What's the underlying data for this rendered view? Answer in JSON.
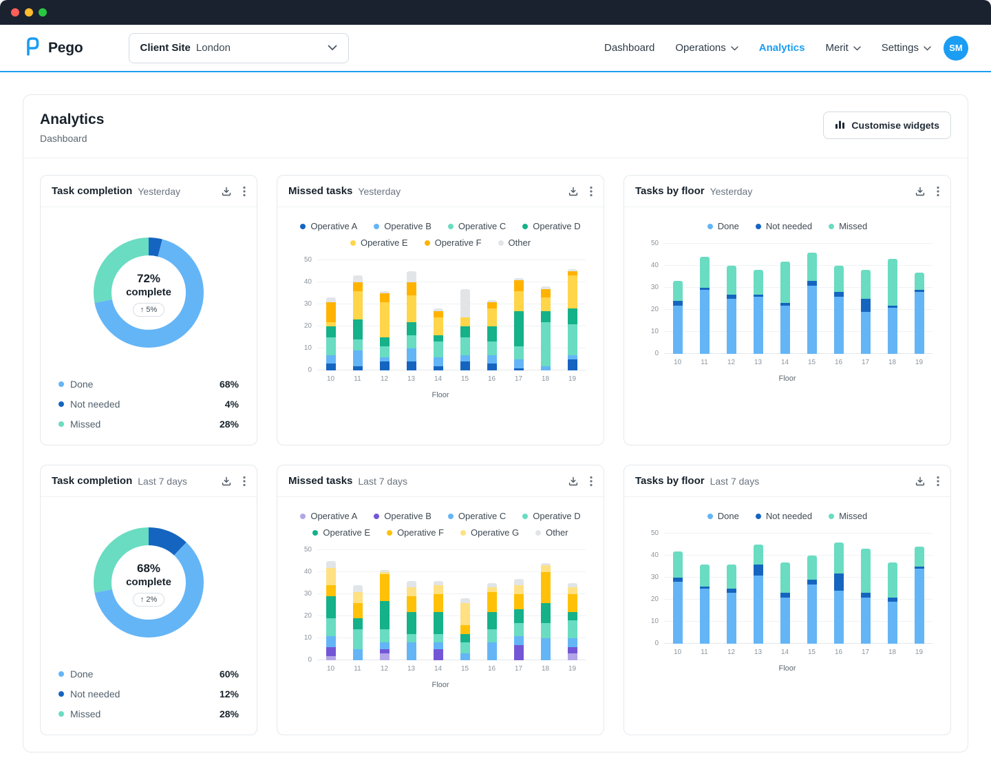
{
  "colors": {
    "accent_blue": "#1b9df3",
    "done_blue": "#64b5f6",
    "not_needed_blue": "#1565c0",
    "missed_mint": "#69dcc1"
  },
  "header": {
    "logo_text": "Pego",
    "client_site": {
      "label": "Client Site",
      "value": "London"
    },
    "nav": [
      {
        "label": "Dashboard"
      },
      {
        "label": "Operations"
      },
      {
        "label": "Analytics"
      },
      {
        "label": "Merit"
      },
      {
        "label": "Settings"
      }
    ],
    "avatar": "SM"
  },
  "page": {
    "title": "Analytics",
    "subtitle": "Dashboard",
    "customise_button": "Customise widgets"
  },
  "widgets": {
    "task_completion_yesterday": {
      "title": "Task completion",
      "period": "Yesterday"
    },
    "missed_tasks_yesterday": {
      "title": "Missed tasks",
      "period": "Yesterday"
    },
    "tasks_by_floor_yesterday": {
      "title": "Tasks by floor",
      "period": "Yesterday"
    },
    "task_completion_week": {
      "title": "Task completion",
      "period": "Last 7 days"
    },
    "missed_tasks_week": {
      "title": "Missed tasks",
      "period": "Last 7 days"
    },
    "tasks_by_floor_week": {
      "title": "Tasks by floor",
      "period": "Last 7 days"
    }
  },
  "chart_data": [
    {
      "id": "task_completion_yesterday",
      "type": "pie",
      "variant": "donut",
      "categories": [
        "Done",
        "Not needed",
        "Missed"
      ],
      "values": [
        68,
        4,
        28
      ],
      "colors": [
        "#64b5f6",
        "#1565c0",
        "#69dcc1"
      ],
      "draw_order": [
        1,
        0,
        2
      ],
      "center": {
        "value": "72%",
        "label": "complete",
        "delta": "↑ 5%"
      }
    },
    {
      "id": "missed_tasks_yesterday",
      "type": "bar",
      "stacked": true,
      "categories": [
        "10",
        "11",
        "12",
        "13",
        "14",
        "15",
        "16",
        "17",
        "18",
        "19"
      ],
      "xlabel": "Floor",
      "ylim": [
        0,
        50
      ],
      "yticks": [
        0,
        10,
        20,
        30,
        40,
        50
      ],
      "legend_position": "top",
      "grid": true,
      "series": [
        {
          "name": "Operative A",
          "color": "#1565c0",
          "values": [
            3,
            2,
            4,
            4,
            2,
            4,
            3,
            1,
            0,
            5
          ]
        },
        {
          "name": "Operative B",
          "color": "#64b5f6",
          "values": [
            4,
            7,
            2,
            6,
            4,
            3,
            4,
            4,
            2,
            2
          ]
        },
        {
          "name": "Operative C",
          "color": "#69dcc1",
          "values": [
            8,
            5,
            5,
            6,
            7,
            8,
            6,
            6,
            20,
            14
          ]
        },
        {
          "name": "Operative D",
          "color": "#15b188",
          "values": [
            5,
            9,
            4,
            6,
            3,
            5,
            7,
            16,
            5,
            7
          ]
        },
        {
          "name": "Operative E",
          "color": "#ffd54a",
          "values": [
            2,
            13,
            16,
            12,
            8,
            4,
            8,
            9,
            6,
            15
          ]
        },
        {
          "name": "Operative F",
          "color": "#ffb300",
          "values": [
            9,
            4,
            4,
            6,
            3,
            0,
            3,
            5,
            4,
            2
          ]
        },
        {
          "name": "Other",
          "color": "#e1e5e8",
          "values": [
            2,
            3,
            1,
            5,
            1,
            13,
            1,
            1,
            1,
            1
          ]
        }
      ]
    },
    {
      "id": "tasks_by_floor_yesterday",
      "type": "bar",
      "stacked": true,
      "categories": [
        "10",
        "11",
        "12",
        "13",
        "14",
        "15",
        "16",
        "17",
        "18",
        "19"
      ],
      "xlabel": "Floor",
      "ylim": [
        0,
        50
      ],
      "yticks": [
        0,
        10,
        20,
        30,
        40,
        50
      ],
      "legend_position": "top",
      "grid": true,
      "series": [
        {
          "name": "Done",
          "color": "#64b5f6",
          "values": [
            22,
            29,
            25,
            26,
            22,
            31,
            26,
            19,
            21,
            28
          ]
        },
        {
          "name": "Not needed",
          "color": "#1565c0",
          "values": [
            2,
            1,
            2,
            1,
            1,
            2,
            2,
            6,
            1,
            1
          ]
        },
        {
          "name": "Missed",
          "color": "#69dcc1",
          "values": [
            9,
            14,
            13,
            11,
            19,
            13,
            12,
            13,
            21,
            8
          ]
        }
      ]
    },
    {
      "id": "task_completion_week",
      "type": "pie",
      "variant": "donut",
      "categories": [
        "Done",
        "Not needed",
        "Missed"
      ],
      "values": [
        60,
        12,
        28
      ],
      "colors": [
        "#64b5f6",
        "#1565c0",
        "#69dcc1"
      ],
      "draw_order": [
        1,
        0,
        2
      ],
      "center": {
        "value": "68%",
        "label": "complete",
        "delta": "↑ 2%"
      }
    },
    {
      "id": "missed_tasks_week",
      "type": "bar",
      "stacked": true,
      "categories": [
        "10",
        "11",
        "12",
        "13",
        "14",
        "15",
        "16",
        "17",
        "18",
        "19"
      ],
      "xlabel": "Floor",
      "ylim": [
        0,
        50
      ],
      "yticks": [
        0,
        10,
        20,
        30,
        40,
        50
      ],
      "legend_position": "top",
      "grid": true,
      "series": [
        {
          "name": "Operative A",
          "color": "#b3a5e8",
          "values": [
            2,
            0,
            3,
            0,
            0,
            0,
            0,
            0,
            0,
            3
          ]
        },
        {
          "name": "Operative B",
          "color": "#7356d6",
          "values": [
            4,
            0,
            2,
            0,
            5,
            0,
            0,
            7,
            0,
            3
          ]
        },
        {
          "name": "Operative C",
          "color": "#64b5f6",
          "values": [
            5,
            5,
            3,
            8,
            3,
            3,
            8,
            4,
            10,
            4
          ]
        },
        {
          "name": "Operative D",
          "color": "#69dcc1",
          "values": [
            8,
            9,
            6,
            4,
            4,
            5,
            6,
            6,
            7,
            8
          ]
        },
        {
          "name": "Operative E",
          "color": "#15b188",
          "values": [
            10,
            5,
            13,
            10,
            10,
            4,
            8,
            6,
            9,
            4
          ]
        },
        {
          "name": "Operative F",
          "color": "#ffc107",
          "values": [
            5,
            7,
            12,
            7,
            8,
            4,
            9,
            7,
            14,
            8
          ]
        },
        {
          "name": "Operative G",
          "color": "#ffe082",
          "values": [
            8,
            5,
            1,
            4,
            4,
            10,
            2,
            4,
            3,
            3
          ]
        },
        {
          "name": "Other",
          "color": "#e1e5e8",
          "values": [
            3,
            3,
            1,
            3,
            2,
            2,
            2,
            3,
            1,
            2
          ]
        }
      ]
    },
    {
      "id": "tasks_by_floor_week",
      "type": "bar",
      "stacked": true,
      "categories": [
        "10",
        "11",
        "12",
        "13",
        "14",
        "15",
        "16",
        "17",
        "18",
        "19"
      ],
      "xlabel": "Floor",
      "ylim": [
        0,
        50
      ],
      "yticks": [
        0,
        10,
        20,
        30,
        40,
        50
      ],
      "legend_position": "top",
      "grid": true,
      "series": [
        {
          "name": "Done",
          "color": "#64b5f6",
          "values": [
            28,
            25,
            23,
            31,
            21,
            27,
            24,
            21,
            19,
            34
          ]
        },
        {
          "name": "Not needed",
          "color": "#1565c0",
          "values": [
            2,
            1,
            2,
            5,
            2,
            2,
            8,
            2,
            2,
            1
          ]
        },
        {
          "name": "Missed",
          "color": "#69dcc1",
          "values": [
            12,
            10,
            11,
            9,
            14,
            11,
            14,
            20,
            16,
            9
          ]
        }
      ]
    }
  ]
}
